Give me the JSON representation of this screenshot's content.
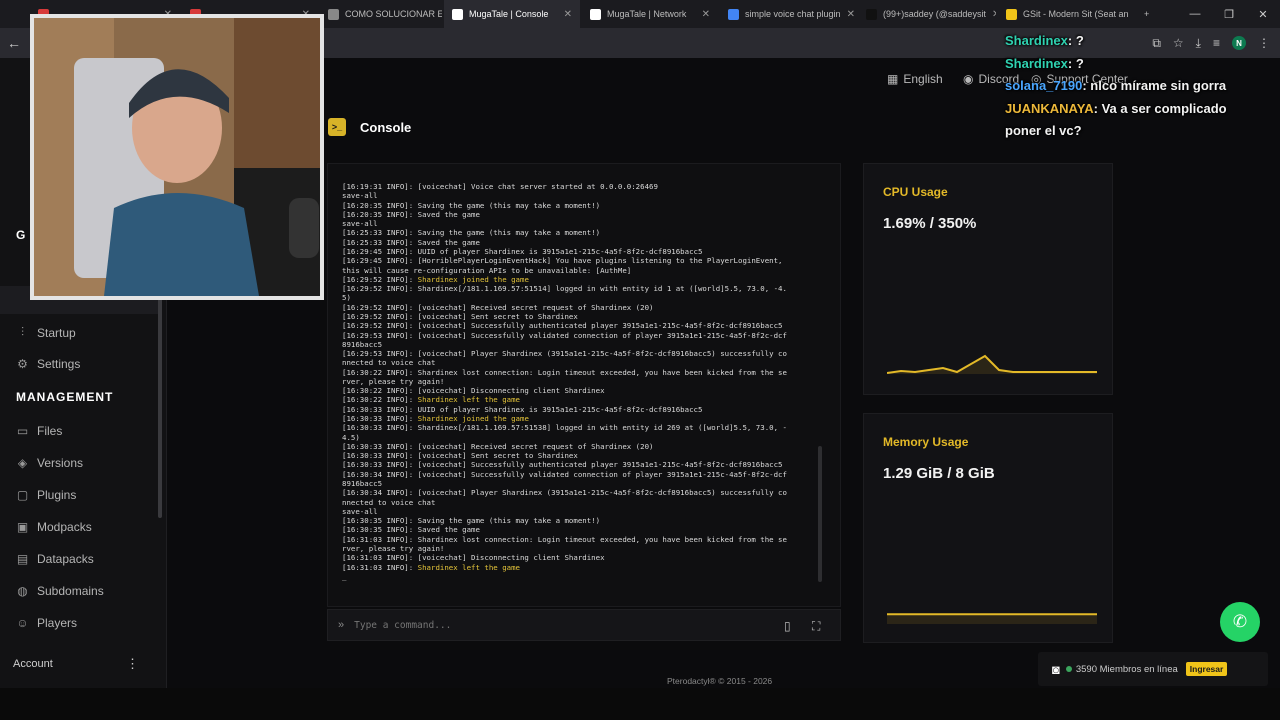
{
  "browser": {
    "tabs": [
      {
        "title": "",
        "favicon_color": "#d73a3a",
        "active": false
      },
      {
        "title": "",
        "favicon_color": "#d73a3a",
        "active": false
      },
      {
        "title": "COMO SOLUCIONAR ER",
        "favicon_color": "#888888",
        "active": false
      },
      {
        "title": "MugaTale | Console",
        "favicon_color": "#ffffff",
        "active": true
      },
      {
        "title": "MugaTale | Network",
        "favicon_color": "#ffffff",
        "active": false
      },
      {
        "title": "simple voice chat plugin",
        "favicon_color": "#4285f4",
        "active": false
      },
      {
        "title": "(99+)saddey (@saddeysit",
        "favicon_color": "#111111",
        "active": false
      },
      {
        "title": "GSit - Modern Sit (Seat an",
        "favicon_color": "#f0c419",
        "active": false
      }
    ],
    "new_tab": "+",
    "profile_initial": "N"
  },
  "sidebar": {
    "section_prefix": "G",
    "items_top": [
      {
        "label": "Startup",
        "icon": "sliders-icon"
      },
      {
        "label": "Settings",
        "icon": "gear-icon"
      }
    ],
    "management_heading": "MANAGEMENT",
    "items_management": [
      {
        "label": "Files",
        "icon": "folder-icon"
      },
      {
        "label": "Versions",
        "icon": "layers-icon"
      },
      {
        "label": "Plugins",
        "icon": "plug-icon"
      },
      {
        "label": "Modpacks",
        "icon": "box-icon"
      },
      {
        "label": "Datapacks",
        "icon": "package-icon"
      },
      {
        "label": "Subdomains",
        "icon": "globe-icon"
      },
      {
        "label": "Players",
        "icon": "users-icon"
      }
    ],
    "account": "Account"
  },
  "header": {
    "language": "English",
    "discord": "Discord",
    "support": "Support Center"
  },
  "console": {
    "title": "Console",
    "command_placeholder": "Type a command...",
    "log": [
      {
        "t": "[16:19:31 INFO]: [voicechat] Voice chat server started at 0.0.0.0:26469"
      },
      {
        "t": "save-all"
      },
      {
        "t": "[16:20:35 INFO]: Saving the game (this may take a moment!)"
      },
      {
        "t": "[16:20:35 INFO]: Saved the game"
      },
      {
        "t": "save-all"
      },
      {
        "t": "[16:25:33 INFO]: Saving the game (this may take a moment!)"
      },
      {
        "t": "[16:25:33 INFO]: Saved the game"
      },
      {
        "t": "[16:29:45 INFO]: UUID of player Shardinex is 3915a1e1-215c-4a5f-8f2c-dcf8916bacc5"
      },
      {
        "t": "[16:29:45 INFO]: [HorriblePlayerLoginEventHack] You have plugins listening to the PlayerLoginEvent,"
      },
      {
        "t": "this will cause re-configuration APIs to be unavailable: [AuthMe]"
      },
      {
        "t": "[16:29:52 INFO]: ",
        "y": "Shardinex joined the game"
      },
      {
        "t": "[16:29:52 INFO]: Shardinex[/181.1.169.57:51514] logged in with entity id 1 at ([world]5.5, 73.0, -4."
      },
      {
        "t": "5)"
      },
      {
        "t": "[16:29:52 INFO]: [voicechat] Received secret request of Shardinex (20)"
      },
      {
        "t": "[16:29:52 INFO]: [voicechat] Sent secret to Shardinex"
      },
      {
        "t": "[16:29:52 INFO]: [voicechat] Successfully authenticated player 3915a1e1-215c-4a5f-8f2c-dcf8916bacc5"
      },
      {
        "t": "[16:29:53 INFO]: [voicechat] Successfully validated connection of player 3915a1e1-215c-4a5f-8f2c-dcf"
      },
      {
        "t": "8916bacc5"
      },
      {
        "t": "[16:29:53 INFO]: [voicechat] Player Shardinex (3915a1e1-215c-4a5f-8f2c-dcf8916bacc5) successfully co"
      },
      {
        "t": "nnected to voice chat"
      },
      {
        "t": "[16:30:22 INFO]: Shardinex lost connection: Login timeout exceeded, you have been kicked from the se"
      },
      {
        "t": "rver, please try again!"
      },
      {
        "t": "[16:30:22 INFO]: [voicechat] Disconnecting client Shardinex"
      },
      {
        "t": "[16:30:22 INFO]: ",
        "y": "Shardinex left the game"
      },
      {
        "t": "[16:30:33 INFO]: UUID of player Shardinex is 3915a1e1-215c-4a5f-8f2c-dcf8916bacc5"
      },
      {
        "t": "[16:30:33 INFO]: ",
        "y": "Shardinex joined the game"
      },
      {
        "t": "[16:30:33 INFO]: Shardinex[/181.1.169.57:51538] logged in with entity id 269 at ([world]5.5, 73.0, -"
      },
      {
        "t": "4.5)"
      },
      {
        "t": "[16:30:33 INFO]: [voicechat] Received secret request of Shardinex (20)"
      },
      {
        "t": "[16:30:33 INFO]: [voicechat] Sent secret to Shardinex"
      },
      {
        "t": "[16:30:33 INFO]: [voicechat] Successfully authenticated player 3915a1e1-215c-4a5f-8f2c-dcf8916bacc5"
      },
      {
        "t": "[16:30:34 INFO]: [voicechat] Successfully validated connection of player 3915a1e1-215c-4a5f-8f2c-dcf"
      },
      {
        "t": "8916bacc5"
      },
      {
        "t": "[16:30:34 INFO]: [voicechat] Player Shardinex (3915a1e1-215c-4a5f-8f2c-dcf8916bacc5) successfully co"
      },
      {
        "t": "nnected to voice chat"
      },
      {
        "t": "save-all"
      },
      {
        "t": "[16:30:35 INFO]: Saving the game (this may take a moment!)"
      },
      {
        "t": "[16:30:35 INFO]: Saved the game"
      },
      {
        "t": "[16:31:03 INFO]: Shardinex lost connection: Login timeout exceeded, you have been kicked from the se"
      },
      {
        "t": "rver, please try again!"
      },
      {
        "t": "[16:31:03 INFO]: [voicechat] Disconnecting client Shardinex"
      },
      {
        "t": "[16:31:03 INFO]: ",
        "y": "Shardinex left the game"
      },
      {
        "t": "_"
      }
    ]
  },
  "stats": {
    "cpu": {
      "title": "CPU Usage",
      "value": "1.69% / 350%",
      "color": "#e3b928"
    },
    "memory": {
      "title": "Memory Usage",
      "value": "1.29 GiB / 8 GiB",
      "color": "#e3b928"
    }
  },
  "chart_data": [
    {
      "type": "area",
      "title": "CPU Usage",
      "values": [
        1,
        3,
        2,
        4,
        6,
        2,
        10,
        18,
        4,
        2,
        2,
        2,
        2,
        2,
        2,
        2
      ],
      "ylim": [
        0,
        60
      ],
      "color": "#e3b928"
    },
    {
      "type": "area",
      "title": "Memory Usage",
      "values": [
        1.29,
        1.29,
        1.29,
        1.29,
        1.29,
        1.29
      ],
      "ylim": [
        0,
        8
      ],
      "color": "#e3b928"
    }
  ],
  "footer": {
    "text": "Pterodactyl® © 2015 - 2026"
  },
  "overlay_chat": [
    {
      "user": "Shardinex",
      "msg": "?",
      "user_color": "#2fd2b1"
    },
    {
      "user": "Shardinex",
      "msg": "?",
      "user_color": "#2fd2b1"
    },
    {
      "user": "solana_7190",
      "msg": "nlco mírame sin gorra",
      "user_color": "#4aa6ff"
    },
    {
      "user": "JUANKANAYA",
      "msg": "Va a ser complicado poner el vc?",
      "user_color": "#ecb83a"
    }
  ],
  "discord_widget": {
    "members": "3590 Miembros en línea",
    "join": "Ingresar"
  }
}
